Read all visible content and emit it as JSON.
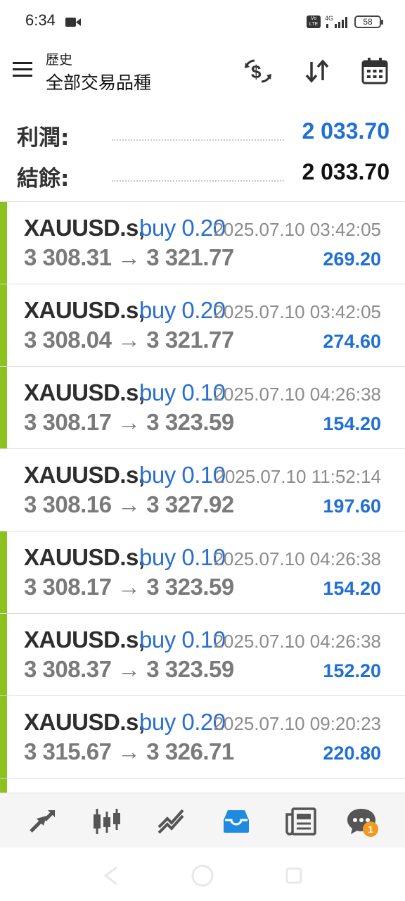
{
  "status_bar": {
    "time": "6:34",
    "network": "4G",
    "battery": "58"
  },
  "header": {
    "subtitle": "歷史",
    "title": "全部交易品種"
  },
  "summary": {
    "profit_label": "利潤:",
    "profit_value": "2 033.70",
    "balance_label": "結餘:",
    "balance_value": "2 033.70"
  },
  "colors": {
    "accent_blue": "#1f6fd6",
    "buy_bar_green": "#8bc21d",
    "text_gray": "#7a7a7a"
  },
  "trades": [
    {
      "symbol": "XAUUSD.s,",
      "side": "buy 0.20",
      "time": "2025.07.10 03:42:05",
      "prices": "3 308.31 → 3 321.77",
      "profit": "269.20",
      "bar": true
    },
    {
      "symbol": "XAUUSD.s,",
      "side": "buy 0.20",
      "time": "2025.07.10 03:42:05",
      "prices": "3 308.04 → 3 321.77",
      "profit": "274.60",
      "bar": true
    },
    {
      "symbol": "XAUUSD.s,",
      "side": "buy 0.10",
      "time": "2025.07.10 04:26:38",
      "prices": "3 308.17 → 3 323.59",
      "profit": "154.20",
      "bar": true
    },
    {
      "symbol": "XAUUSD.s,",
      "side": "buy 0.10",
      "time": "2025.07.10 11:52:14",
      "prices": "3 308.16 → 3 327.92",
      "profit": "197.60",
      "bar": false
    },
    {
      "symbol": "XAUUSD.s,",
      "side": "buy 0.10",
      "time": "2025.07.10 04:26:38",
      "prices": "3 308.17 → 3 323.59",
      "profit": "154.20",
      "bar": true
    },
    {
      "symbol": "XAUUSD.s,",
      "side": "buy 0.10",
      "time": "2025.07.10 04:26:38",
      "prices": "3 308.37 → 3 323.59",
      "profit": "152.20",
      "bar": true
    },
    {
      "symbol": "XAUUSD.s,",
      "side": "buy 0.20",
      "time": "2025.07.10 09:20:23",
      "prices": "3 315.67 → 3 326.71",
      "profit": "220.80",
      "bar": true
    }
  ],
  "bottom_nav": {
    "items": [
      "quotes-icon",
      "chart-icon",
      "trade-icon",
      "history-icon",
      "news-icon",
      "messages-icon"
    ],
    "active": "history-icon",
    "messages_badge": "1"
  }
}
